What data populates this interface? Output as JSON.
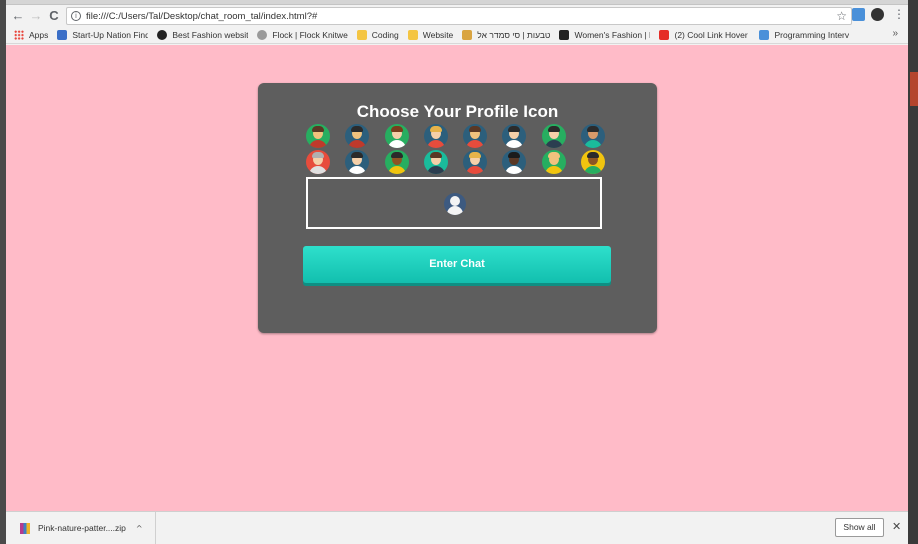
{
  "browser": {
    "url": "file:///C:/Users/Tal/Desktop/chat_room_tal/index.html?#",
    "back_icon": "←",
    "forward_icon": "→",
    "reload_icon": "C",
    "info_icon": "i",
    "star_icon": "☆",
    "menu_icon": "⋮"
  },
  "bookmarks": {
    "items": [
      {
        "label": "Apps",
        "icon": "apps-grid-icon",
        "color": "#e8453c"
      },
      {
        "label": "Start-Up Nation Find",
        "icon": "flag-icon",
        "color": "#3b6fc7"
      },
      {
        "label": "Best Fashion website",
        "icon": "circle-logo-icon",
        "color": "#222222"
      },
      {
        "label": "Flock | Flock Knitwe",
        "icon": "gray-circle-icon",
        "color": "#9a9a9a"
      },
      {
        "label": "Coding",
        "icon": "folder-icon",
        "color": "#f4c542"
      },
      {
        "label": "Website",
        "icon": "folder-icon",
        "color": "#f4c542"
      },
      {
        "label": "טבעות | סי סמדר אל",
        "icon": "s-logo-icon",
        "color": "#d9a441"
      },
      {
        "label": "Women's Fashion | N",
        "icon": "z-logo-icon",
        "color": "#222222"
      },
      {
        "label": "(2) Cool Link Hover E",
        "icon": "youtube-icon",
        "color": "#e52d27"
      },
      {
        "label": "Programming Interv",
        "icon": "swirl-logo-icon",
        "color": "#4a90d9"
      }
    ],
    "more": "»"
  },
  "page": {
    "background": "#ffbbc8",
    "title": "Choose Your Profile Icon",
    "enter_button": "Enter Chat",
    "avatars": [
      {
        "bg": "#27ae60",
        "face": "#f1c27d",
        "hair": "#5a3825",
        "body": "#c0392b"
      },
      {
        "bg": "#2c5f7c",
        "face": "#f1c27d",
        "hair": "#2b2b2b",
        "body": "#c0392b"
      },
      {
        "bg": "#27ae60",
        "face": "#f5d0a9",
        "hair": "#7a3d1d",
        "body": "#ffffff"
      },
      {
        "bg": "#2c5f7c",
        "face": "#f5d0a9",
        "hair": "#e6b34a",
        "body": "#e74c3c"
      },
      {
        "bg": "#2c5f7c",
        "face": "#f1c27d",
        "hair": "#5a3825",
        "body": "#e74c3c"
      },
      {
        "bg": "#2c5f7c",
        "face": "#f5d0a9",
        "hair": "#2b2b2b",
        "body": "#ffffff"
      },
      {
        "bg": "#27ae60",
        "face": "#f5d0a9",
        "hair": "#2b2b2b",
        "body": "#2c3e50"
      },
      {
        "bg": "#2c5f7c",
        "face": "#d89a6a",
        "hair": "#2b2b2b",
        "body": "#1abc9c"
      },
      {
        "bg": "#e74c3c",
        "face": "#f5d0a9",
        "hair": "#b0b0b0",
        "body": "#e0e0e0"
      },
      {
        "bg": "#2c5f7c",
        "face": "#f5d0a9",
        "hair": "#2b2b2b",
        "body": "#ffffff"
      },
      {
        "bg": "#27ae60",
        "face": "#8d5524",
        "hair": "#2b2b2b",
        "body": "#f1c40f"
      },
      {
        "bg": "#1abc9c",
        "face": "#f5d0a9",
        "hair": "#5a3825",
        "body": "#2c3e50"
      },
      {
        "bg": "#2c5f7c",
        "face": "#f5d0a9",
        "hair": "#e6b34a",
        "body": "#e74c3c"
      },
      {
        "bg": "#2c5f7c",
        "face": "#5a3825",
        "hair": "#1b1b1b",
        "body": "#ffffff"
      },
      {
        "bg": "#27ae60",
        "face": "#f1c27d",
        "hair": "#f1c27d",
        "body": "#f1c40f"
      },
      {
        "bg": "#f1c40f",
        "face": "#8d5524",
        "hair": "#2b2b2b",
        "body": "#27ae60"
      }
    ]
  },
  "downloads": {
    "file_name": "Pink-nature-patter....zip",
    "caret": "^",
    "show_all": "Show all",
    "close": "✕"
  }
}
